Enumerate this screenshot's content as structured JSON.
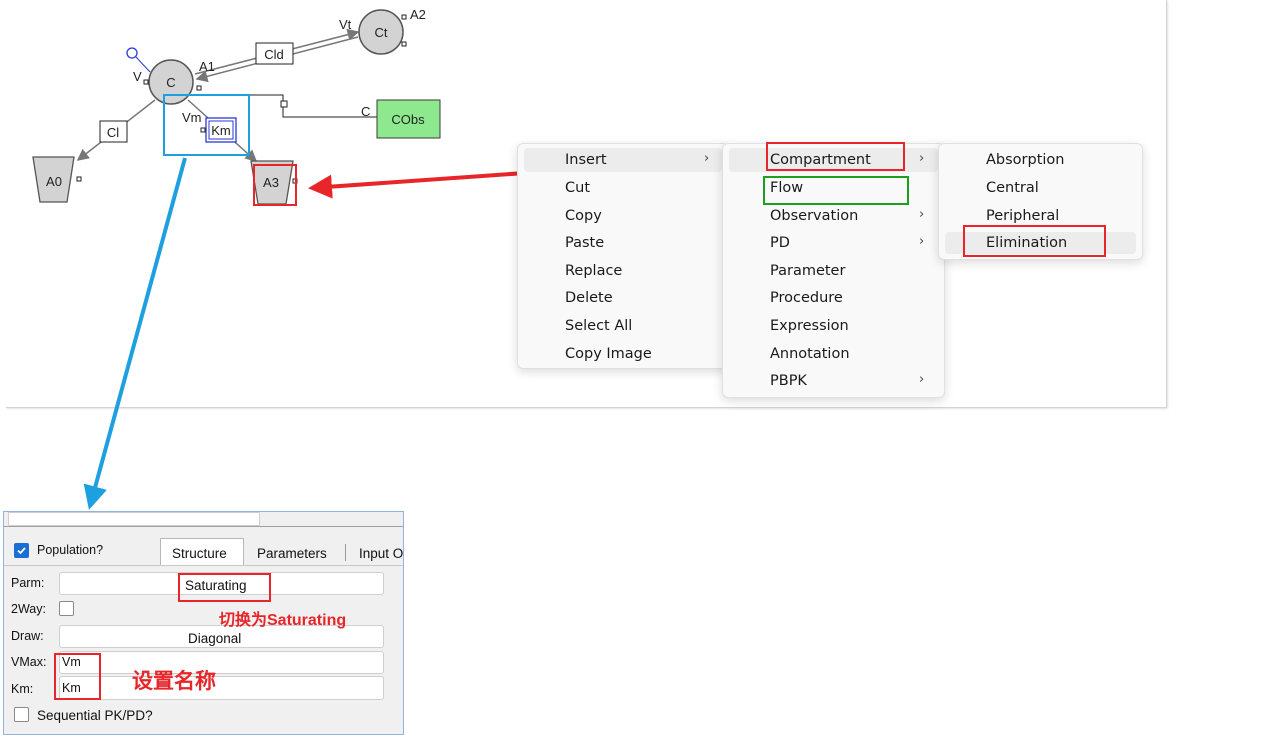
{
  "diagram": {
    "nodes": {
      "c": "C",
      "ct": "Ct",
      "a0": "A0",
      "a3": "A3",
      "cobs": "CObs",
      "cld": "Cld",
      "cl": "Cl",
      "km": "Km"
    },
    "labels": {
      "v": "V",
      "vt": "Vt",
      "a1": "A1",
      "a2": "A2",
      "vm": "Vm",
      "c_obs_link": "C"
    },
    "colors": {
      "cobs_fill": "#8ee88e",
      "node_fill": "#d3d3d3",
      "selection": "#1ea0e0",
      "annotation": "#e8262a"
    }
  },
  "context_menu": {
    "items": [
      "Insert",
      "Cut",
      "Copy",
      "Paste",
      "Replace",
      "Delete",
      "Select All",
      "Copy Image"
    ]
  },
  "insert_submenu": {
    "items": [
      "Compartment",
      "Flow",
      "Observation",
      "PD",
      "Parameter",
      "Procedure",
      "Expression",
      "Annotation",
      "PBPK"
    ]
  },
  "compartment_submenu": {
    "items": [
      "Absorption",
      "Central",
      "Peripheral",
      "Elimination"
    ]
  },
  "properties_panel": {
    "population_label": "Population?",
    "population_checked": true,
    "tabs": [
      "Structure",
      "Parameters",
      "Input O"
    ],
    "active_tab": "Structure",
    "parm_label": "Parm:",
    "parm_value": "Saturating",
    "twoway_label": "2Way:",
    "draw_label": "Draw:",
    "draw_value": "Diagonal",
    "vmax_label": "VMax:",
    "vmax_value": "Vm",
    "km_label": "Km:",
    "km_value": "Km",
    "sequential_label": "Sequential PK/PD?"
  },
  "annotations": {
    "switch_note": "切换为Saturating",
    "name_note": "设置名称"
  }
}
